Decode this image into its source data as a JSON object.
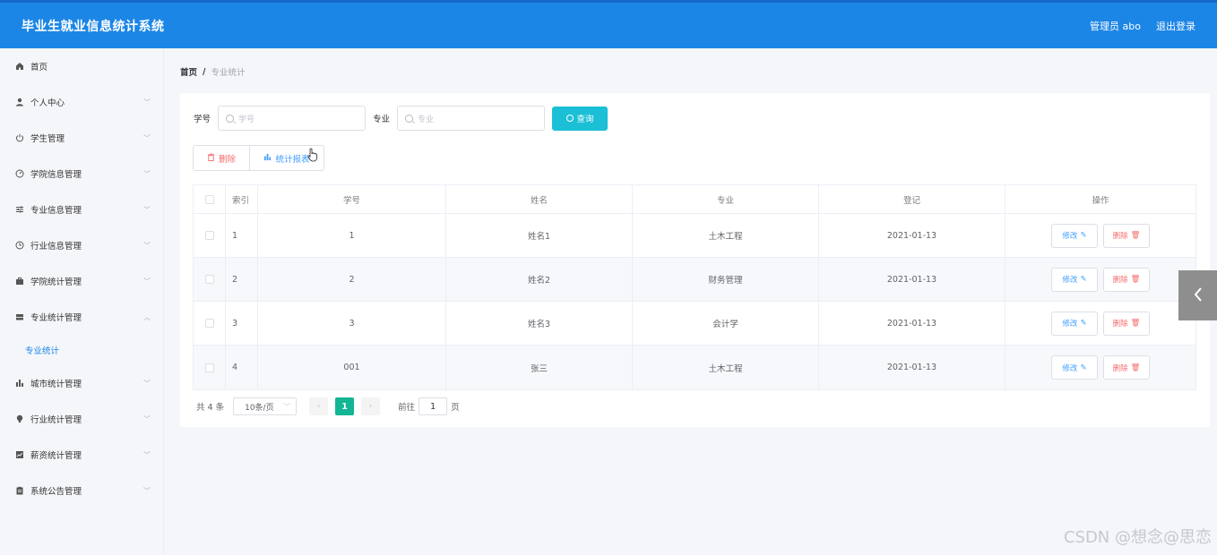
{
  "app": {
    "title": "毕业生就业信息统计系统",
    "user_label": "管理员 abo",
    "logout_label": "退出登录"
  },
  "sidebar": {
    "items": [
      {
        "label": "首页",
        "icon": "home-icon",
        "has_arrow": false
      },
      {
        "label": "个人中心",
        "icon": "user-icon",
        "has_arrow": true
      },
      {
        "label": "学生管理",
        "icon": "power-icon",
        "has_arrow": true
      },
      {
        "label": "学院信息管理",
        "icon": "dashboard-icon",
        "has_arrow": true
      },
      {
        "label": "专业信息管理",
        "icon": "sliders-icon",
        "has_arrow": true
      },
      {
        "label": "行业信息管理",
        "icon": "clock-icon",
        "has_arrow": true
      },
      {
        "label": "学院统计管理",
        "icon": "briefcase-icon",
        "has_arrow": true
      },
      {
        "label": "专业统计管理",
        "icon": "folder-icon",
        "has_arrow": true,
        "expanded": true
      },
      {
        "label": "城市统计管理",
        "icon": "bar-chart-icon",
        "has_arrow": true
      },
      {
        "label": "行业统计管理",
        "icon": "bulb-icon",
        "has_arrow": true
      },
      {
        "label": "薪资统计管理",
        "icon": "trend-icon",
        "has_arrow": true
      },
      {
        "label": "系统公告管理",
        "icon": "clipboard-icon",
        "has_arrow": true
      }
    ],
    "submenu_active": "专业统计"
  },
  "breadcrumb": {
    "home": "首页",
    "separator": "/",
    "current": "专业统计"
  },
  "search": {
    "student_no_label": "学号",
    "student_no_placeholder": "学号",
    "major_label": "专业",
    "major_placeholder": "专业",
    "query_label": "查询"
  },
  "actions": {
    "delete_label": "删除",
    "stats_label": "统计报表"
  },
  "table": {
    "headers": [
      "索引",
      "学号",
      "姓名",
      "专业",
      "登记",
      "操作"
    ],
    "rows": [
      {
        "index": "1",
        "student_no": "1",
        "name": "姓名1",
        "major": "土木工程",
        "date": "2021-01-13"
      },
      {
        "index": "2",
        "student_no": "2",
        "name": "姓名2",
        "major": "财务管理",
        "date": "2021-01-13"
      },
      {
        "index": "3",
        "student_no": "3",
        "name": "姓名3",
        "major": "会计学",
        "date": "2021-01-13"
      },
      {
        "index": "4",
        "student_no": "001",
        "name": "张三",
        "major": "土木工程",
        "date": "2021-01-13"
      }
    ],
    "edit_label": "修改",
    "delete_label": "删除"
  },
  "pagination": {
    "total_text": "共 4 条",
    "page_size": "10条/页",
    "current_page": "1",
    "goto_label": "前往",
    "goto_value": "1",
    "page_unit": "页"
  },
  "watermark": "CSDN @想念@思恋",
  "colors": {
    "header_bg": "#1c86e6",
    "query_btn": "#1bbfd6",
    "active_page": "#13b595",
    "danger": "#f56c6c",
    "primary": "#409eff"
  }
}
